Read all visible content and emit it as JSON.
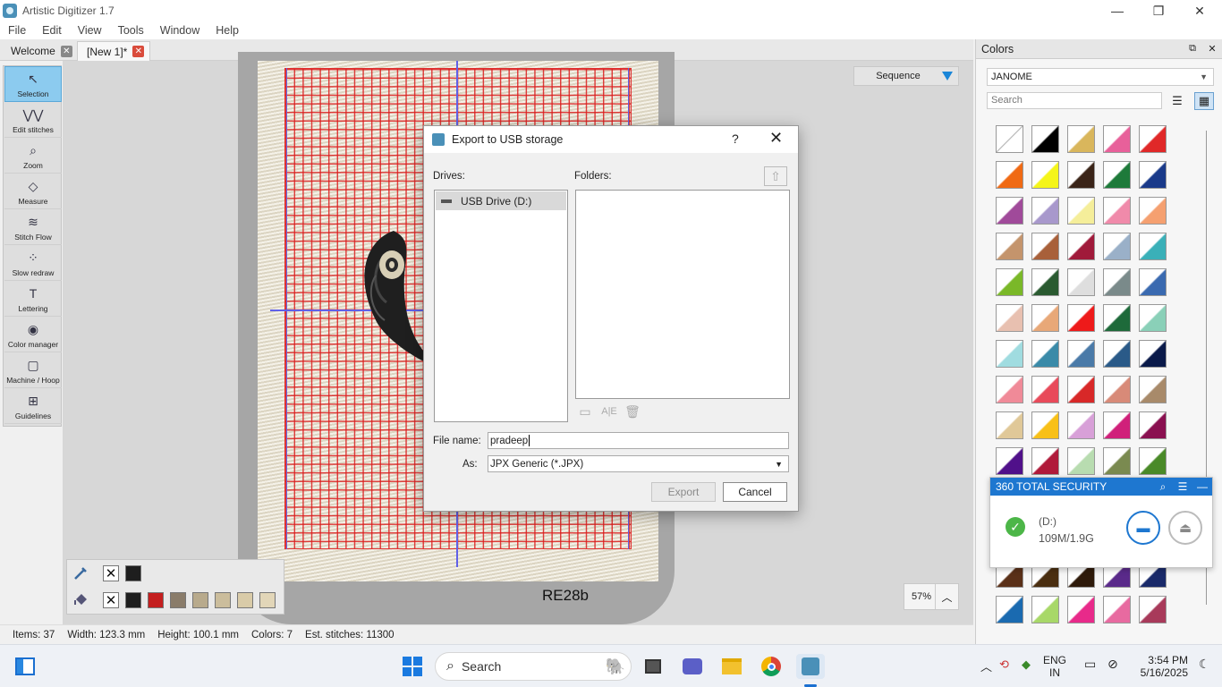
{
  "app": {
    "title": "Artistic Digitizer 1.7"
  },
  "menu": [
    "File",
    "Edit",
    "View",
    "Tools",
    "Window",
    "Help"
  ],
  "tabs": [
    {
      "label": "Welcome",
      "active": false
    },
    {
      "label": "[New 1]*",
      "active": true
    }
  ],
  "toolbar": [
    {
      "label": "Selection",
      "icon": "cursor-icon",
      "glyph": "↖",
      "active": true
    },
    {
      "label": "Edit stitches",
      "icon": "stitch-edit-icon",
      "glyph": "⋁⋁"
    },
    {
      "label": "Zoom",
      "icon": "magnifier-icon",
      "glyph": "⌕"
    },
    {
      "label": "Measure",
      "icon": "ruler-icon",
      "glyph": "◇"
    },
    {
      "label": "Stitch Flow",
      "icon": "stitch-flow-icon",
      "glyph": "≋"
    },
    {
      "label": "Slow redraw",
      "icon": "slow-redraw-icon",
      "glyph": "⁘"
    },
    {
      "label": "Lettering",
      "icon": "lettering-icon",
      "glyph": "T"
    },
    {
      "label": "Color manager",
      "icon": "palette-icon",
      "glyph": "◉"
    },
    {
      "label": "Machine / Hoop",
      "icon": "hoop-icon",
      "glyph": "▢"
    },
    {
      "label": "Guidelines",
      "icon": "guidelines-icon",
      "glyph": "⊞"
    }
  ],
  "canvas": {
    "sequence_label": "Sequence",
    "design_name": "RE28b",
    "zoom": "57%"
  },
  "palette_strip": {
    "row1": [
      "#ffffff",
      "#1e1e1e"
    ],
    "row2": [
      "#ffffff",
      "#1e1e1e",
      "#c41f1f",
      "#8a7c6a",
      "#b8aa8c",
      "#cbbd9c",
      "#d9cba8",
      "#e2d6b8"
    ]
  },
  "status": {
    "items": "Items: 37",
    "width": "Width: 123.3 mm",
    "height": "Height: 100.1 mm",
    "colors": "Colors: 7",
    "stitches": "Est. stitches: 11300"
  },
  "colors_panel": {
    "title": "Colors",
    "brand": "JANOME",
    "search_placeholder": "Search",
    "threads": [
      [
        "#ffffff",
        "#000000",
        "#d9b65c",
        "#e8609a",
        "#e02828"
      ],
      [
        "#f06a14",
        "#f5f51a",
        "#3a2418",
        "#1e7a3a",
        "#1a3a8a"
      ],
      [
        "#a04a9a",
        "#a898cc",
        "#f5ee9a",
        "#f08aaa",
        "#f5a070"
      ],
      [
        "#c4946c",
        "#a8603a",
        "#a01a3a",
        "#9ab0c8",
        "#3ab0b8"
      ],
      [
        "#7ab828",
        "#2a5a30",
        "#dedede",
        "#7a8a8a",
        "#3a6ab0"
      ],
      [
        "#e8c0b0",
        "#e8a878",
        "#ee1a1a",
        "#1e6a3a",
        "#8ad0b8"
      ],
      [
        "#a0dce0",
        "#3a8aa8",
        "#4a7aa8",
        "#2a5a88",
        "#0a1a4a"
      ],
      [
        "#f08a98",
        "#e84a5a",
        "#d82828",
        "#d88a78",
        "#a88a6a"
      ],
      [
        "#e0c898",
        "#f8c018",
        "#d8a0d8",
        "#d0207a",
        "#8a1050"
      ],
      [
        "#50108a",
        "#b01a3a",
        "#b8dcb0",
        "#7a8a50",
        "#4a8a28"
      ]
    ],
    "bottom_threads": [
      [
        "#5a3018",
        "#4a2e10",
        "#2e1a0a",
        "#5a2a8a",
        "#1a2a6a"
      ],
      [
        "#1a6ab0",
        "#a8d868",
        "#e82a8a",
        "#e86aa0",
        "#a83a5a"
      ]
    ]
  },
  "security_popup": {
    "title": "360 TOTAL SECURITY",
    "drive": "(D:)",
    "size": "109M/1.9G"
  },
  "dialog": {
    "title": "Export to USB storage",
    "help": "?",
    "drives_label": "Drives:",
    "folders_label": "Folders:",
    "drive_item": "USB Drive (D:)",
    "filename_label": "File name:",
    "filename_value": "pradeep",
    "as_label": "As:",
    "as_value": "JPX Generic (*.JPX)",
    "export_label": "Export",
    "cancel_label": "Cancel"
  },
  "taskbar": {
    "search_placeholder": "Search",
    "lang_top": "ENG",
    "lang_bottom": "IN",
    "time": "3:54 PM",
    "date": "5/16/2025"
  }
}
